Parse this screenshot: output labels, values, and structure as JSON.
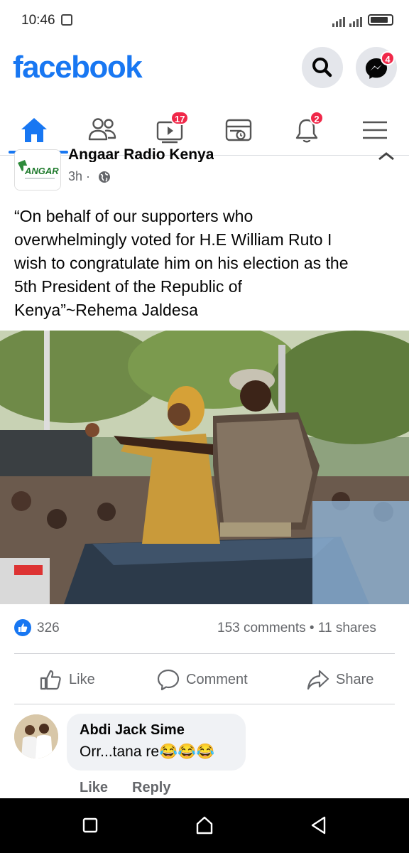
{
  "status_bar": {
    "time": "10:46"
  },
  "header": {
    "logo": "facebook",
    "messenger_badge": "4"
  },
  "nav": {
    "items": [
      {
        "name": "home",
        "badge": ""
      },
      {
        "name": "friends",
        "badge": ""
      },
      {
        "name": "watch",
        "badge": "17"
      },
      {
        "name": "feeds",
        "badge": ""
      },
      {
        "name": "notifications",
        "badge": "2"
      },
      {
        "name": "menu",
        "badge": ""
      }
    ]
  },
  "post": {
    "page_name": "Angaar Radio Kenya",
    "avatar_text": "ANGAR",
    "time": "3h ·",
    "text": "“On behalf of our supporters who\noverwhelmingly voted for H.E William Ruto I\nwish to congratulate him on his election as the\n5th President of the Republic of\nKenya”~Rehema Jaldesa",
    "likes": "326",
    "stats": "153 comments • 11 shares"
  },
  "actions": {
    "like": "Like",
    "comment": "Comment",
    "share": "Share"
  },
  "comment": {
    "author": "Abdi Jack Sime",
    "text": "Orr...tana re😂😂😂",
    "like": "Like",
    "reply": "Reply"
  },
  "colors": {
    "brand": "#1877f2",
    "badge": "#f02849",
    "secondary_text": "#65676b"
  }
}
